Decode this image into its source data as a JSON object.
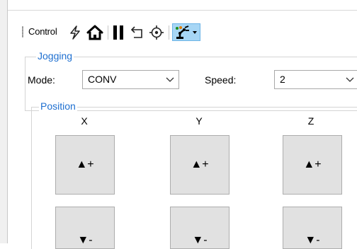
{
  "toolbar": {
    "label": "Control",
    "icons": [
      "lightning-icon",
      "home-icon",
      "pause-icon",
      "undo-icon",
      "target-icon",
      "robot-icon"
    ],
    "active_color": "#a7d6f5"
  },
  "jogging": {
    "title": "Jogging",
    "mode_label": "Mode:",
    "mode_value": "CONV",
    "speed_label": "Speed:",
    "speed_value": "2"
  },
  "position": {
    "title": "Position",
    "axes": [
      "X",
      "Y",
      "Z"
    ],
    "plus_label": "+",
    "minus_label": "-"
  }
}
